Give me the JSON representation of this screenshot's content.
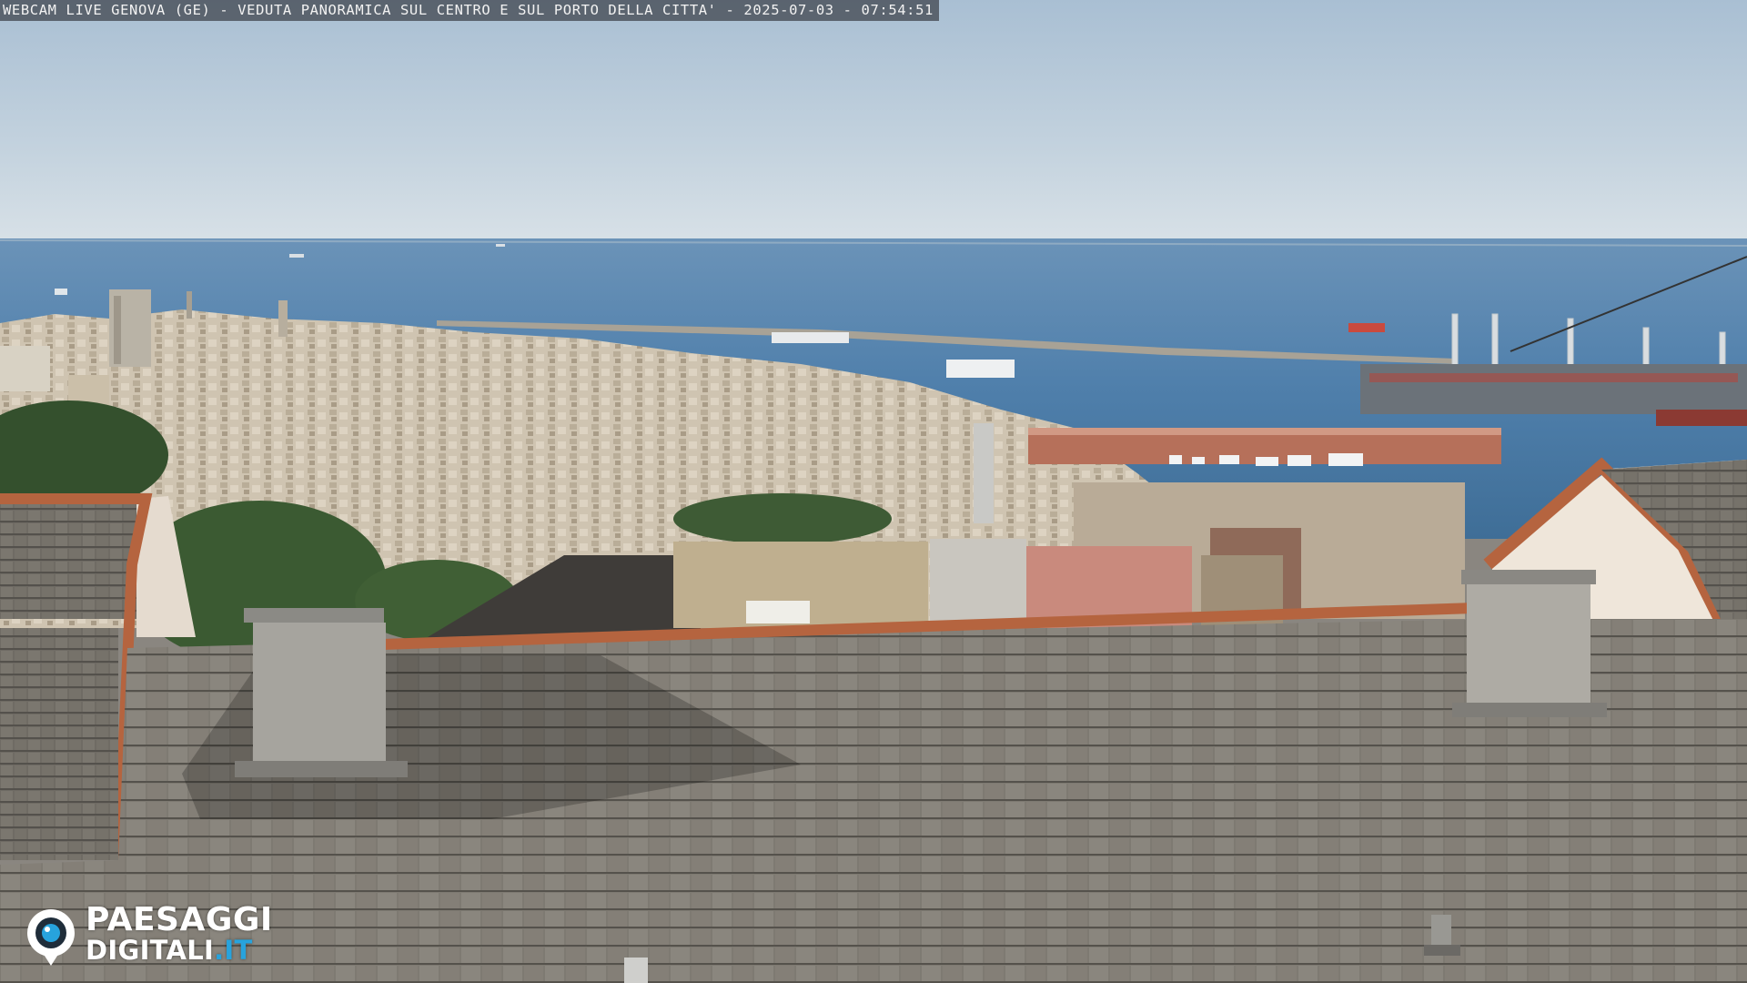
{
  "overlay": {
    "title": "WEBCAM LIVE GENOVA (GE) - VEDUTA PANORAMICA SUL CENTRO E SUL PORTO DELLA CITTA' - 2025-07-03 - 07:54:51"
  },
  "logo": {
    "line1": "PAESAGGI",
    "line2_main": "DIGITALI",
    "line2_accent": ".IT",
    "accent_color": "#27a3dd"
  },
  "colors": {
    "sky_top": "#a9bfd3",
    "sky_horizon": "#d5dfe6",
    "sea": "#4e80ad",
    "roof_tiles": "#7d7a73",
    "terracotta": "#b5643f"
  }
}
